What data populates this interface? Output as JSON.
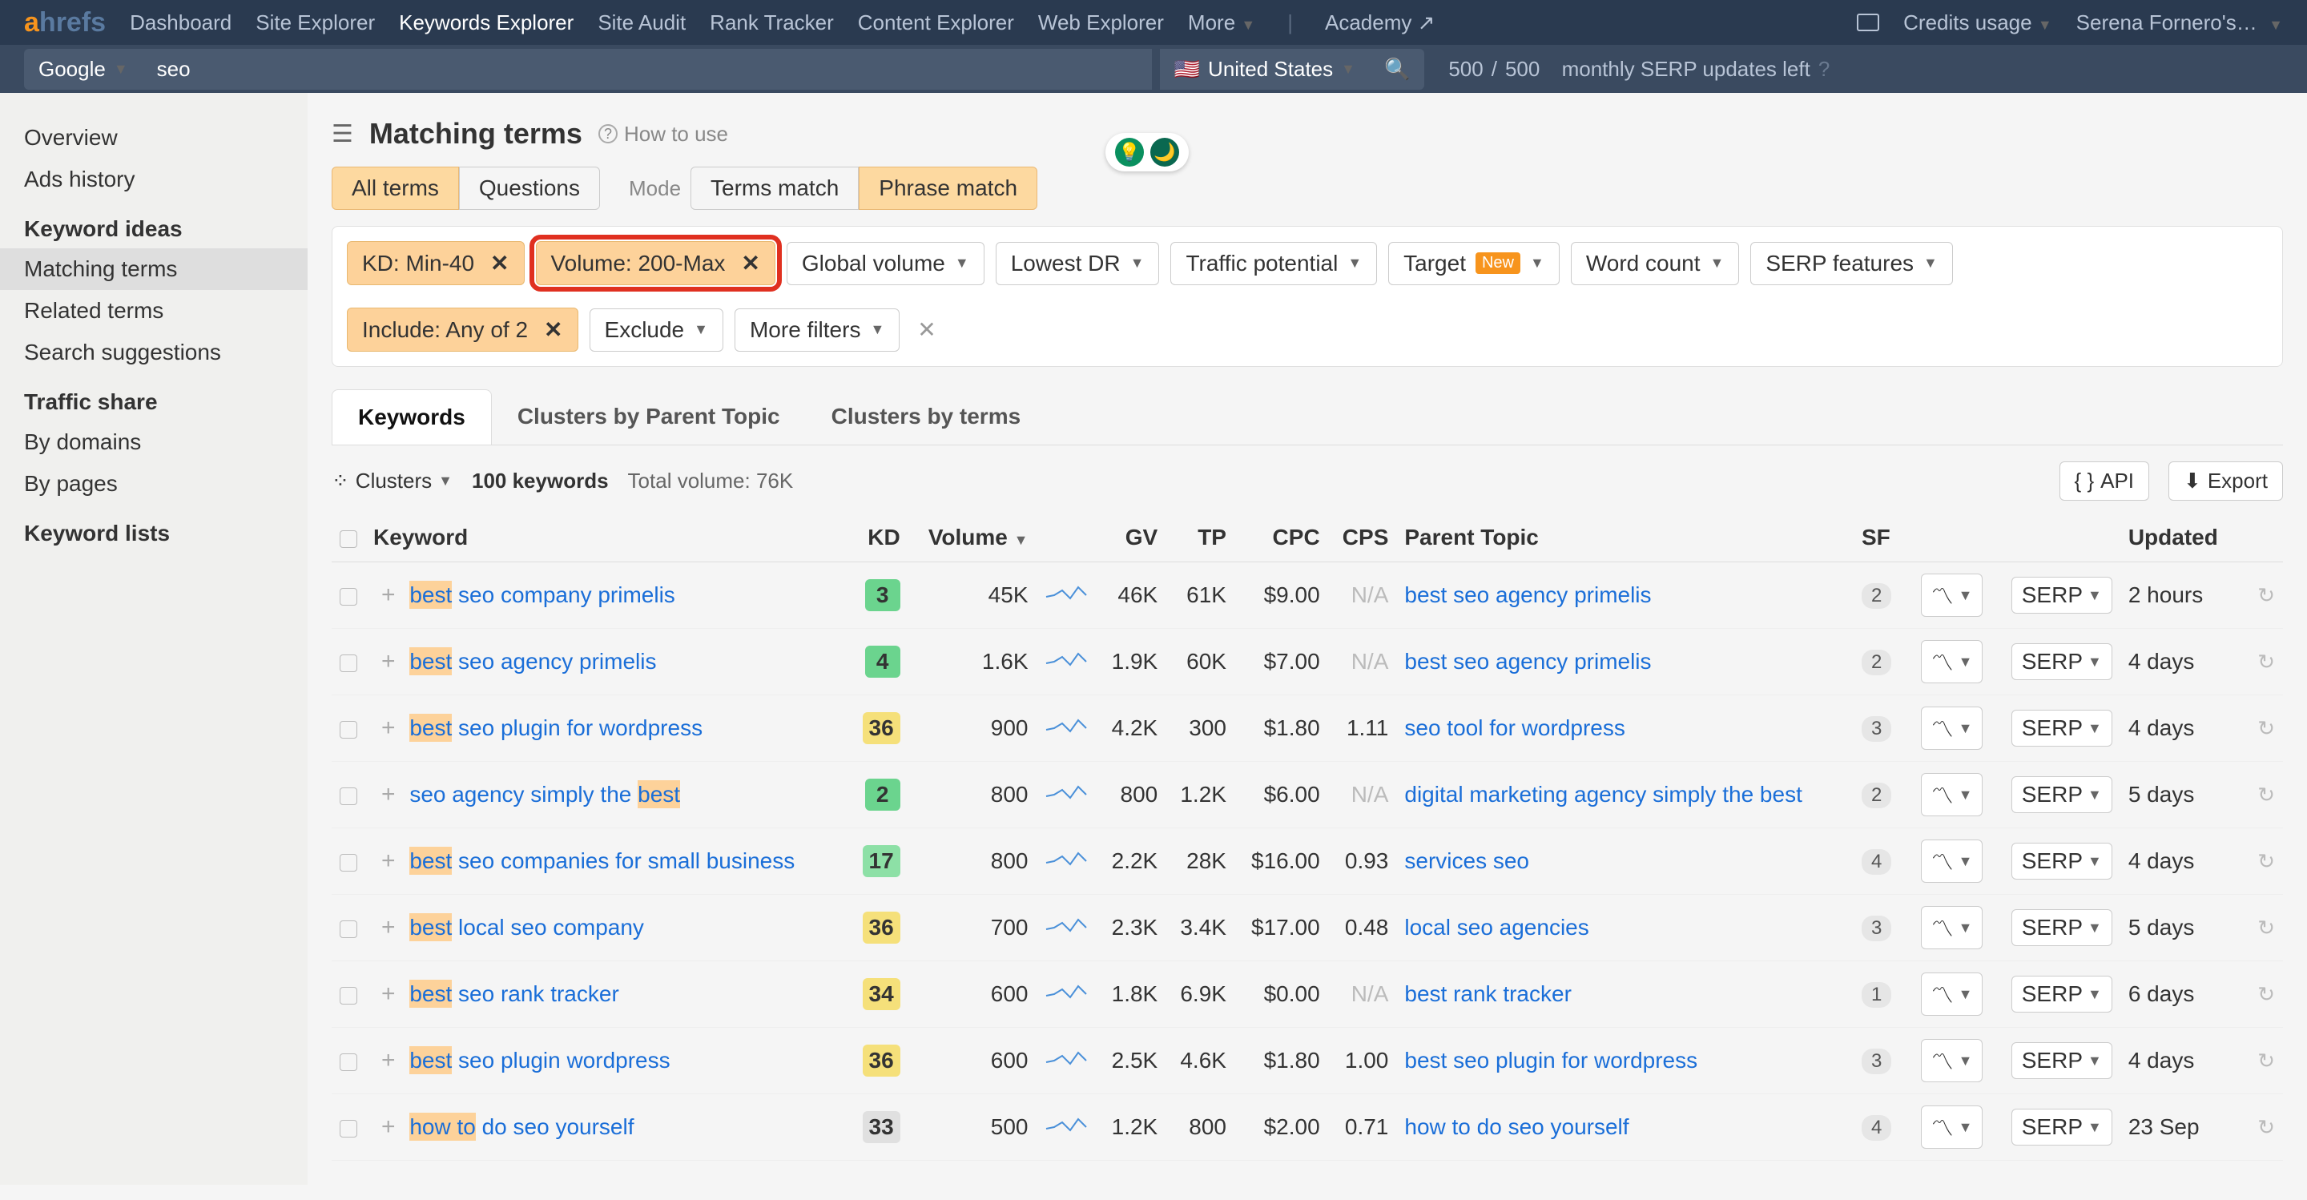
{
  "logo": {
    "a": "a",
    "rest": "hrefs"
  },
  "topnav": [
    "Dashboard",
    "Site Explorer",
    "Keywords Explorer",
    "Site Audit",
    "Rank Tracker",
    "Content Explorer",
    "Web Explorer",
    "More"
  ],
  "topnav_active": "Keywords Explorer",
  "academy": "Academy",
  "topright": {
    "credits": "Credits usage",
    "account": "Serena Fornero's…"
  },
  "search": {
    "engine": "Google",
    "query": "seo",
    "country": "United States"
  },
  "credits_text": {
    "used": "500",
    "total": "500",
    "suffix": "monthly SERP updates left"
  },
  "sidebar": {
    "top": [
      "Overview",
      "Ads history"
    ],
    "ideas_heading": "Keyword ideas",
    "ideas": [
      "Matching terms",
      "Related terms",
      "Search suggestions"
    ],
    "traffic_heading": "Traffic share",
    "traffic": [
      "By domains",
      "By pages"
    ],
    "lists_heading": "Keyword lists"
  },
  "page": {
    "title": "Matching terms",
    "howto": "How to use"
  },
  "pill1": {
    "all": "All terms",
    "q": "Questions"
  },
  "mode_label": "Mode",
  "pill2": {
    "terms": "Terms match",
    "phrase": "Phrase match"
  },
  "filters": {
    "kd": "KD: Min-40",
    "volume": "Volume: 200-Max",
    "gv": "Global volume",
    "lowestdr": "Lowest DR",
    "tp": "Traffic potential",
    "target": "Target",
    "target_new": "New",
    "wc": "Word count",
    "serpfeat": "SERP features",
    "include": "Include: Any of 2",
    "exclude": "Exclude",
    "more": "More filters"
  },
  "tabs": [
    "Keywords",
    "Clusters by Parent Topic",
    "Clusters by terms"
  ],
  "toolbar": {
    "clusters": "Clusters",
    "count": "100 keywords",
    "total": "Total volume: 76K",
    "api": "API",
    "export": "Export"
  },
  "columns": {
    "kw": "Keyword",
    "kd": "KD",
    "vol": "Volume",
    "gv": "GV",
    "tp": "TP",
    "cpc": "CPC",
    "cps": "CPS",
    "parent": "Parent Topic",
    "sf": "SF",
    "updated": "Updated"
  },
  "rows": [
    {
      "hl": "best",
      "kw": " seo company primelis",
      "kd": "3",
      "kdc": "kd-darkgreen",
      "vol": "45K",
      "gv": "46K",
      "tp": "61K",
      "cpc": "$9.00",
      "cps": "N/A",
      "parent": "best seo agency primelis",
      "sf": "2",
      "updated": "2 hours"
    },
    {
      "hl": "best",
      "kw": " seo agency primelis",
      "kd": "4",
      "kdc": "kd-darkgreen",
      "vol": "1.6K",
      "gv": "1.9K",
      "tp": "60K",
      "cpc": "$7.00",
      "cps": "N/A",
      "parent": "best seo agency primelis",
      "sf": "2",
      "updated": "4 days"
    },
    {
      "hl": "best",
      "kw": " seo plugin for wordpress",
      "kd": "36",
      "kdc": "kd-yellow",
      "vol": "900",
      "gv": "4.2K",
      "tp": "300",
      "cpc": "$1.80",
      "cps": "1.11",
      "parent": "seo tool for wordpress",
      "sf": "3",
      "updated": "4 days"
    },
    {
      "hl_suffix": "best",
      "kw": "seo agency simply the ",
      "kd": "2",
      "kdc": "kd-darkgreen",
      "vol": "800",
      "gv": "800",
      "tp": "1.2K",
      "cpc": "$6.00",
      "cps": "N/A",
      "parent": "digital marketing agency simply the best",
      "sf": "2",
      "updated": "5 days"
    },
    {
      "hl": "best",
      "kw": " seo companies for small business",
      "kd": "17",
      "kdc": "kd-green",
      "vol": "800",
      "gv": "2.2K",
      "tp": "28K",
      "cpc": "$16.00",
      "cps": "0.93",
      "parent": "services seo",
      "sf": "4",
      "updated": "4 days"
    },
    {
      "hl": "best",
      "kw": " local seo company",
      "kd": "36",
      "kdc": "kd-yellow",
      "vol": "700",
      "gv": "2.3K",
      "tp": "3.4K",
      "cpc": "$17.00",
      "cps": "0.48",
      "parent": "local seo agencies",
      "sf": "3",
      "updated": "5 days"
    },
    {
      "hl": "best",
      "kw": " seo rank tracker",
      "kd": "34",
      "kdc": "kd-yellow",
      "vol": "600",
      "gv": "1.8K",
      "tp": "6.9K",
      "cpc": "$0.00",
      "cps": "N/A",
      "parent": "best rank tracker",
      "sf": "1",
      "updated": "6 days"
    },
    {
      "hl": "best",
      "kw": " seo plugin wordpress",
      "kd": "36",
      "kdc": "kd-yellow",
      "vol": "600",
      "gv": "2.5K",
      "tp": "4.6K",
      "cpc": "$1.80",
      "cps": "1.00",
      "parent": "best seo plugin for wordpress",
      "sf": "3",
      "updated": "4 days"
    },
    {
      "hl": "how to",
      "kw": " do seo yourself",
      "kd": "33",
      "kdc": "kd-gray",
      "vol": "500",
      "gv": "1.2K",
      "tp": "800",
      "cpc": "$2.00",
      "cps": "0.71",
      "parent": "how to do seo yourself",
      "sf": "4",
      "updated": "23 Sep"
    }
  ],
  "serp_label": "SERP"
}
